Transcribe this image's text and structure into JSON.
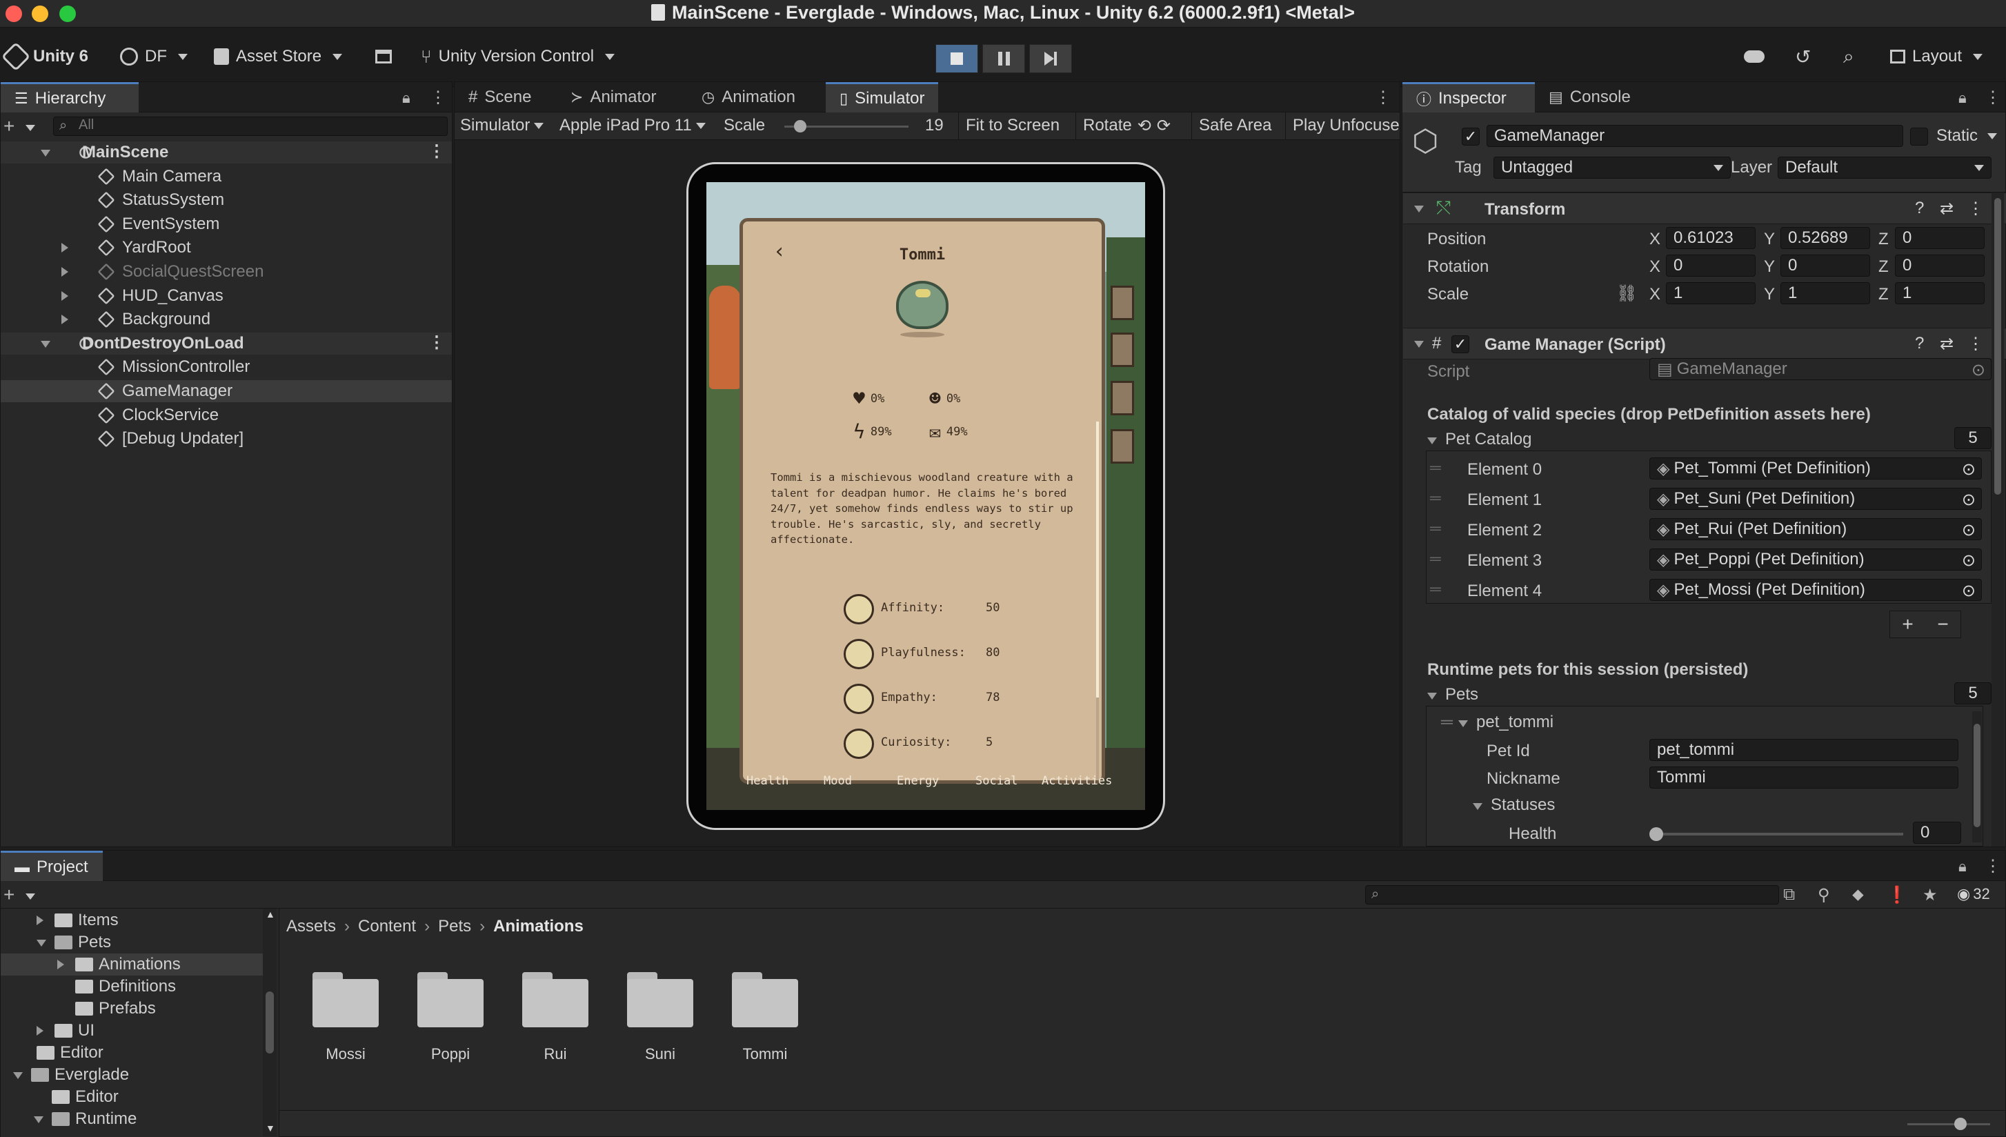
{
  "window": {
    "title": "MainScene - Everglade - Windows, Mac, Linux - Unity 6.2 (6000.2.9f1) <Metal>"
  },
  "toolbar": {
    "unity_label": "Unity 6",
    "account": "DF",
    "asset_store": "Asset Store",
    "version_control": "Unity Version Control",
    "layout": "Layout"
  },
  "hierarchy": {
    "tab": "Hierarchy",
    "search_placeholder": "All",
    "items": [
      {
        "label": "MainScene"
      },
      {
        "label": "Main Camera"
      },
      {
        "label": "StatusSystem"
      },
      {
        "label": "EventSystem"
      },
      {
        "label": "YardRoot"
      },
      {
        "label": "SocialQuestScreen"
      },
      {
        "label": "HUD_Canvas"
      },
      {
        "label": "Background"
      },
      {
        "label": "DontDestroyOnLoad"
      },
      {
        "label": "MissionController"
      },
      {
        "label": "GameManager"
      },
      {
        "label": "ClockService"
      },
      {
        "label": "[Debug Updater]"
      }
    ]
  },
  "center": {
    "tabs": [
      "Scene",
      "Animator",
      "Animation",
      "Simulator"
    ],
    "sim_toolbar": {
      "mode": "Simulator",
      "device": "Apple iPad Pro 11",
      "scale_label": "Scale",
      "scale_value": "19",
      "scale_fraction": 0.08,
      "fit": "Fit to Screen",
      "rotate": "Rotate",
      "safe_area": "Safe Area",
      "play_unfocused": "Play Unfocuse"
    }
  },
  "game": {
    "pet_name": "Tommi",
    "stats": [
      {
        "icon": "heart-icon",
        "value": "0%"
      },
      {
        "icon": "face-icon",
        "value": "0%"
      },
      {
        "icon": "energy-icon",
        "value": "89%"
      },
      {
        "icon": "chat-icon",
        "value": "49%"
      }
    ],
    "description": "Tommi is a mischievous woodland creature with a talent for deadpan humor. He claims he's bored 24/7, yet somehow finds endless ways to stir up trouble. He's sarcastic, sly, and secretly affectionate.",
    "traits": [
      {
        "label": "Affinity:",
        "value": "50"
      },
      {
        "label": "Playfulness:",
        "value": "80"
      },
      {
        "label": "Empathy:",
        "value": "78"
      },
      {
        "label": "Curiosity:",
        "value": "5"
      }
    ],
    "bottom_nav": [
      "Health",
      "Mood",
      "Energy",
      "Social",
      "Activities"
    ]
  },
  "inspector": {
    "tabs": [
      "Inspector",
      "Console"
    ],
    "object_name": "GameManager",
    "static_label": "Static",
    "tag_label": "Tag",
    "tag_value": "Untagged",
    "layer_label": "Layer",
    "layer_value": "Default",
    "transform": {
      "title": "Transform",
      "position": {
        "label": "Position",
        "x": "0.61023",
        "y": "0.52689",
        "z": "0"
      },
      "rotation": {
        "label": "Rotation",
        "x": "0",
        "y": "0",
        "z": "0"
      },
      "scale": {
        "label": "Scale",
        "x": "1",
        "y": "1",
        "z": "1"
      }
    },
    "script_component": {
      "title": "Game Manager (Script)",
      "script_label": "Script",
      "script_value": "GameManager",
      "catalog_header": "Catalog of valid species (drop PetDefinition assets here)",
      "catalog_label": "Pet Catalog",
      "catalog_count": "5",
      "catalog": [
        {
          "label": "Element 0",
          "value": "Pet_Tommi (Pet Definition)"
        },
        {
          "label": "Element 1",
          "value": "Pet_Suni (Pet Definition)"
        },
        {
          "label": "Element 2",
          "value": "Pet_Rui (Pet Definition)"
        },
        {
          "label": "Element 3",
          "value": "Pet_Poppi (Pet Definition)"
        },
        {
          "label": "Element 4",
          "value": "Pet_Mossi (Pet Definition)"
        }
      ],
      "runtime_header": "Runtime pets for this session (persisted)",
      "pets_label": "Pets",
      "pets_count": "5",
      "pet0": {
        "label": "pet_tommi",
        "pet_id_label": "Pet Id",
        "pet_id": "pet_tommi",
        "nickname_label": "Nickname",
        "nickname": "Tommi",
        "statuses_label": "Statuses",
        "health_label": "Health",
        "health_value": "0"
      }
    }
  },
  "project": {
    "tab": "Project",
    "count": "32",
    "tree": [
      {
        "label": "Items"
      },
      {
        "label": "Pets"
      },
      {
        "label": "Animations"
      },
      {
        "label": "Definitions"
      },
      {
        "label": "Prefabs"
      },
      {
        "label": "UI"
      },
      {
        "label": "Editor"
      },
      {
        "label": "Everglade"
      },
      {
        "label": "Editor"
      },
      {
        "label": "Runtime"
      }
    ],
    "breadcrumb": [
      "Assets",
      "Content",
      "Pets",
      "Animations"
    ],
    "folders": [
      "Mossi",
      "Poppi",
      "Rui",
      "Suni",
      "Tommi"
    ]
  }
}
